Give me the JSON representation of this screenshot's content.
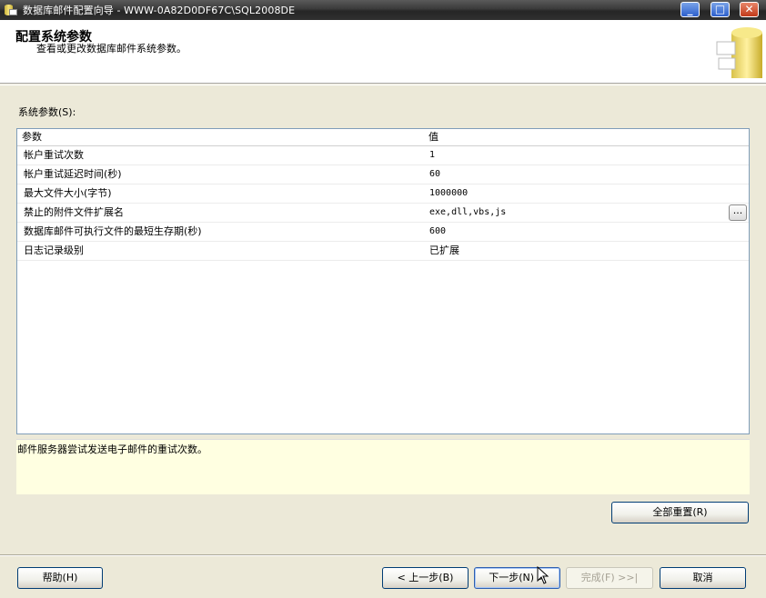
{
  "window": {
    "title": "数据库邮件配置向导 - WWW-0A82D0DF67C\\SQL2008DE",
    "controls": [
      "minimize-icon",
      "maximize-icon",
      "close-icon"
    ]
  },
  "header": {
    "title": "配置系统参数",
    "subtitle": "查看或更改数据库邮件系统参数。"
  },
  "params": {
    "label": "系统参数(S):",
    "columns": {
      "name": "参数",
      "value": "值"
    },
    "rows": [
      {
        "name": "帐户重试次数",
        "value": "1"
      },
      {
        "name": "帐户重试延迟时间(秒)",
        "value": "60"
      },
      {
        "name": "最大文件大小(字节)",
        "value": "1000000"
      },
      {
        "name": "禁止的附件文件扩展名",
        "value": "exe,dll,vbs,js"
      },
      {
        "name": "数据库邮件可执行文件的最短生存期(秒)",
        "value": "600"
      },
      {
        "name": "日志记录级别",
        "value": "已扩展"
      }
    ],
    "ellipsis": "..."
  },
  "description": "邮件服务器尝试发送电子邮件的重试次数。",
  "buttons": {
    "reset_all": "全部重置(R)",
    "help": "帮助(H)",
    "back": "< 上一步(B)",
    "next": "下一步(N) >",
    "finish": "完成(F) >>|",
    "cancel": "取消"
  }
}
